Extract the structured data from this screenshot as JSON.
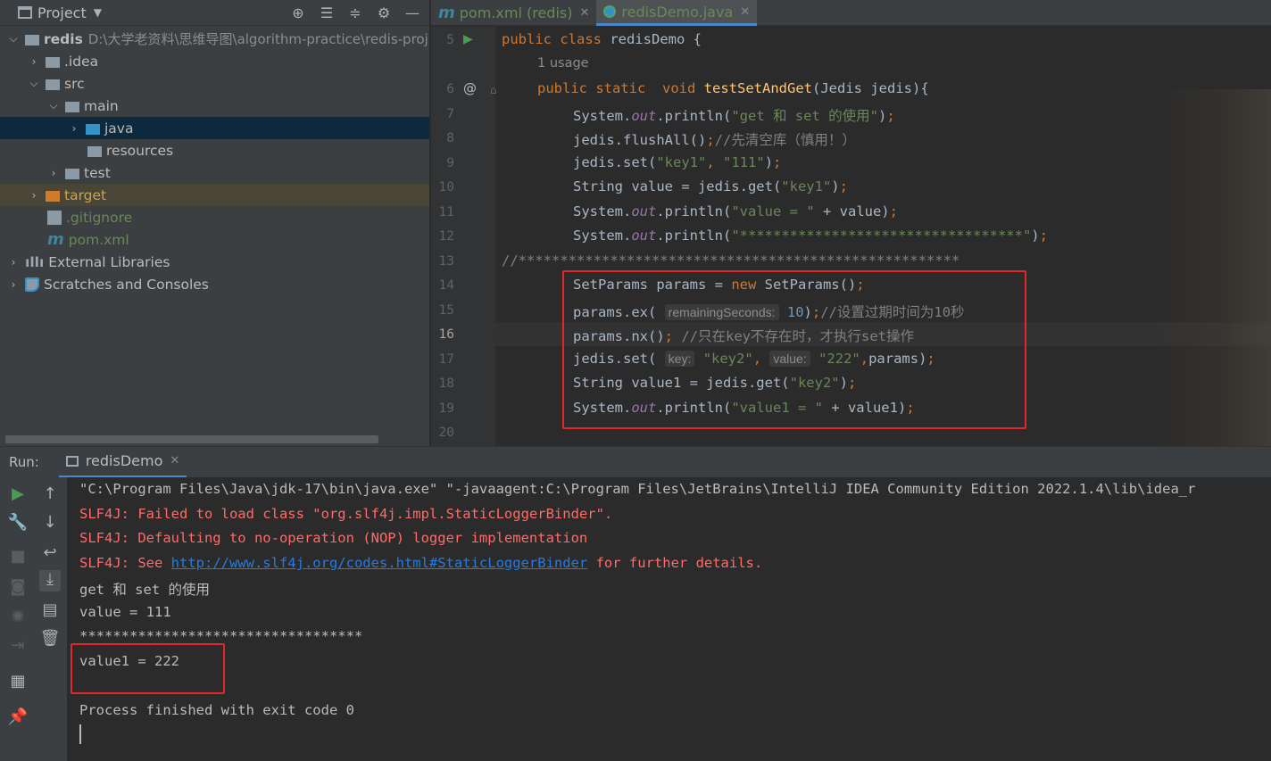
{
  "project_panel": {
    "title": "Project",
    "toolbar_icons": [
      "crosshair-icon",
      "expand-all-icon",
      "collapse-all-icon",
      "gear-icon",
      "minimize-icon"
    ],
    "tree": [
      {
        "label": "redis",
        "path": "D:\\大学老资料\\思维导图\\algorithm-practice\\redis-proj",
        "expanded": true
      },
      {
        "label": ".idea",
        "expanded": false
      },
      {
        "label": "src",
        "expanded": true
      },
      {
        "label": "main",
        "expanded": true
      },
      {
        "label": "java",
        "expanded": false,
        "selected": true
      },
      {
        "label": "resources"
      },
      {
        "label": "test",
        "expanded": false
      },
      {
        "label": "target",
        "expanded": false
      },
      {
        "label": ".gitignore"
      },
      {
        "label": "pom.xml"
      },
      {
        "label": "External Libraries",
        "expanded": false
      },
      {
        "label": "Scratches and Consoles",
        "expanded": false
      }
    ]
  },
  "editor_tabs": [
    {
      "label": "pom.xml (redis)",
      "active": false
    },
    {
      "label": "redisDemo.java",
      "active": true
    }
  ],
  "editor": {
    "usage_hint": "1 usage",
    "line_numbers": [
      "5",
      "6",
      "7",
      "8",
      "9",
      "10",
      "11",
      "12",
      "13",
      "14",
      "15",
      "16",
      "17",
      "18",
      "19",
      "20"
    ],
    "current_line": "16",
    "hints": {
      "remaining": "remainingSeconds:",
      "key": "key:",
      "value": "value:"
    }
  },
  "run_panel": {
    "label": "Run:",
    "tab": "redisDemo",
    "output": [
      "\"C:\\Program Files\\Java\\jdk-17\\bin\\java.exe\" \"-javaagent:C:\\Program Files\\JetBrains\\IntelliJ IDEA Community Edition 2022.1.4\\lib\\idea_r",
      "SLF4J: Failed to load class \"org.slf4j.impl.StaticLoggerBinder\".",
      "SLF4J: Defaulting to no-operation (NOP) logger implementation",
      "SLF4J: See ",
      "get 和 set 的使用",
      "value = 111",
      "**********************************",
      "value1 = 222",
      "Process finished with exit code 0"
    ],
    "slf4j_link": "http://www.slf4j.org/codes.html#StaticLoggerBinder",
    "slf4j_tail": " for further details."
  }
}
